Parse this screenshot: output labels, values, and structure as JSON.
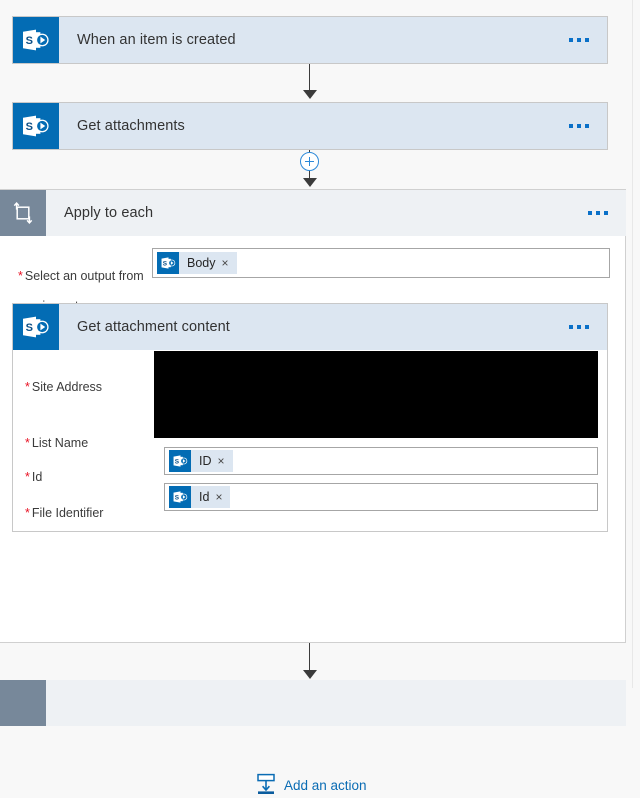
{
  "flow": {
    "steps": [
      {
        "id": "trigger",
        "title": "When an item is created",
        "icon": "sharepoint-icon",
        "menu_label": "…"
      },
      {
        "id": "get-attachments",
        "title": "Get attachments",
        "icon": "sharepoint-icon",
        "menu_label": "…"
      },
      {
        "id": "apply-to-each",
        "title": "Apply to each",
        "icon": "loop-icon",
        "menu_label": "…"
      }
    ],
    "insert_node": {
      "name": "add-step-plus",
      "label": "+"
    }
  },
  "apply_to_each": {
    "title": "Apply to each",
    "output_field": {
      "label_line1": "Select an output from",
      "label_line2": "previous steps",
      "required": true,
      "token": {
        "label": "Body",
        "icon": "sharepoint-icon",
        "remove_label": "×"
      }
    },
    "inner_action": {
      "title": "Get attachment content",
      "icon": "sharepoint-icon",
      "menu_label": "…",
      "fields": [
        {
          "label": "Site Address",
          "required": true,
          "value": "",
          "redacted": true
        },
        {
          "label": "List Name",
          "required": true,
          "value": "",
          "redacted": true
        },
        {
          "label": "Id",
          "required": true,
          "redacted": false,
          "token": {
            "label": "ID",
            "icon": "sharepoint-icon",
            "remove_label": "×"
          }
        },
        {
          "label": "File Identifier",
          "required": true,
          "redacted": false,
          "token": {
            "label": "Id",
            "icon": "sharepoint-icon",
            "remove_label": "×"
          }
        }
      ]
    },
    "add_action": {
      "label": "Add an action",
      "icon": "add-action-icon"
    }
  },
  "colors": {
    "accent_blue": "#036cb4",
    "header_blue": "#dce6f1",
    "loop_gray": "#77889a",
    "link_blue": "#0a6cb4",
    "required_red": "#e81123",
    "canvas": "#f8f8f8"
  }
}
